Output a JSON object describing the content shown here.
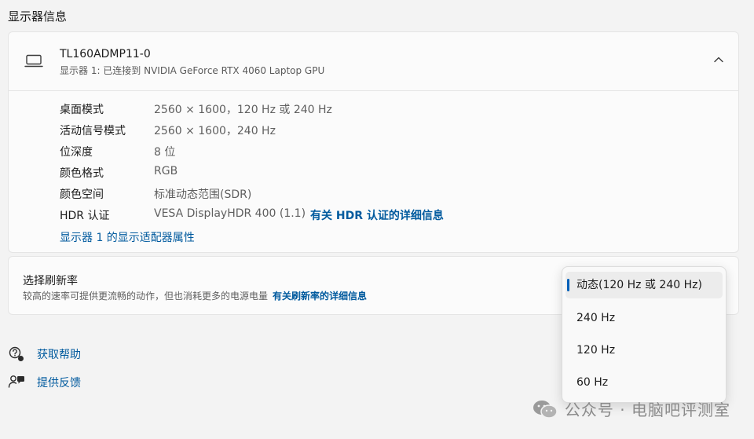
{
  "section_title": "显示器信息",
  "display": {
    "name": "TL160ADMP11-0",
    "subtitle": "显示器 1: 已连接到 NVIDIA GeForce RTX 4060 Laptop GPU",
    "rows": [
      {
        "key": "桌面模式",
        "value": "2560 × 1600，120 Hz 或 240 Hz"
      },
      {
        "key": "活动信号模式",
        "value": "2560 × 1600，240 Hz"
      },
      {
        "key": "位深度",
        "value": "8 位"
      },
      {
        "key": "颜色格式",
        "value": "RGB"
      },
      {
        "key": "颜色空间",
        "value": "标准动态范围(SDR)"
      },
      {
        "key": "HDR 认证",
        "value": "VESA DisplayHDR 400 (1.1)",
        "link": "有关 HDR 认证的详细信息"
      }
    ],
    "adapter_link": "显示器 1 的显示适配器属性"
  },
  "refresh": {
    "title": "选择刷新率",
    "description": "较高的速率可提供更流畅的动作，但也消耗更多的电源电量",
    "link": "有关刷新率的详细信息",
    "options": [
      "动态(120 Hz 或 240 Hz)",
      "240 Hz",
      "120 Hz",
      "60 Hz"
    ],
    "selected_index": 0
  },
  "help": {
    "get_help": "获取帮助",
    "feedback": "提供反馈"
  },
  "watermark": "公众号 · 电脑吧评测室",
  "colors": {
    "accent": "#005fb8",
    "link": "#005a9e"
  }
}
